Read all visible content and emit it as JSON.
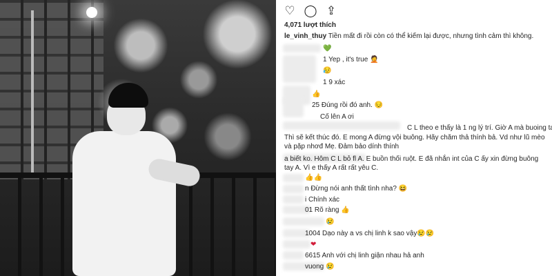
{
  "post": {
    "likes": "4,071 lượt thích",
    "caption_user": "le_vinh_thuy",
    "caption_text": "Tiền mất đi rồi còn có thể kiếm lại được, nhưng tình cảm thì không."
  },
  "comments": [
    {
      "text": "💚"
    },
    {
      "text": "1 Yep , it's true 🤦"
    },
    {
      "text": "😥"
    },
    {
      "text": "1 9 xác"
    },
    {
      "text": "👍"
    },
    {
      "text": "25 Đúng rồi đó anh. 😔"
    },
    {
      "text": "Cố lên A ơi"
    },
    {
      "text": "C L theo e thấy là 1 ng lý trí. Giờ A mà buoing tay."
    },
    {
      "text": "Thì sẽ kết thúc đó. E mong A đừng vội buông. Hãy chăm thả thính bả. Vd như lũ mèo và pặp nhơđ Mẹ. Đảm bảo dính thính"
    },
    {
      "text": "a biết ko. Hôm C L bỏ fl A. E buồn thối ruột. E đã nhắn int của C ấy xin đừng buông tay A. Vì e thấy A rất rất yêu C."
    },
    {
      "text": "👍👍"
    },
    {
      "text": "n Đừng nói anh thất tình nha? 😆"
    },
    {
      "text": "i Chính xác"
    },
    {
      "text": "01 Rõ ràng 👍"
    },
    {
      "text": "😢"
    },
    {
      "text": "1004 Dạo này a vs chị linh k sao vậy😢😢"
    },
    {
      "text": "❤"
    },
    {
      "text": "6615 Anh với chị linh giận nhau hả anh"
    },
    {
      "text": "vuong 😢"
    }
  ],
  "icons": {
    "like": "heart-outline-icon",
    "comment": "comment-bubble-icon",
    "share": "share-upload-icon"
  }
}
